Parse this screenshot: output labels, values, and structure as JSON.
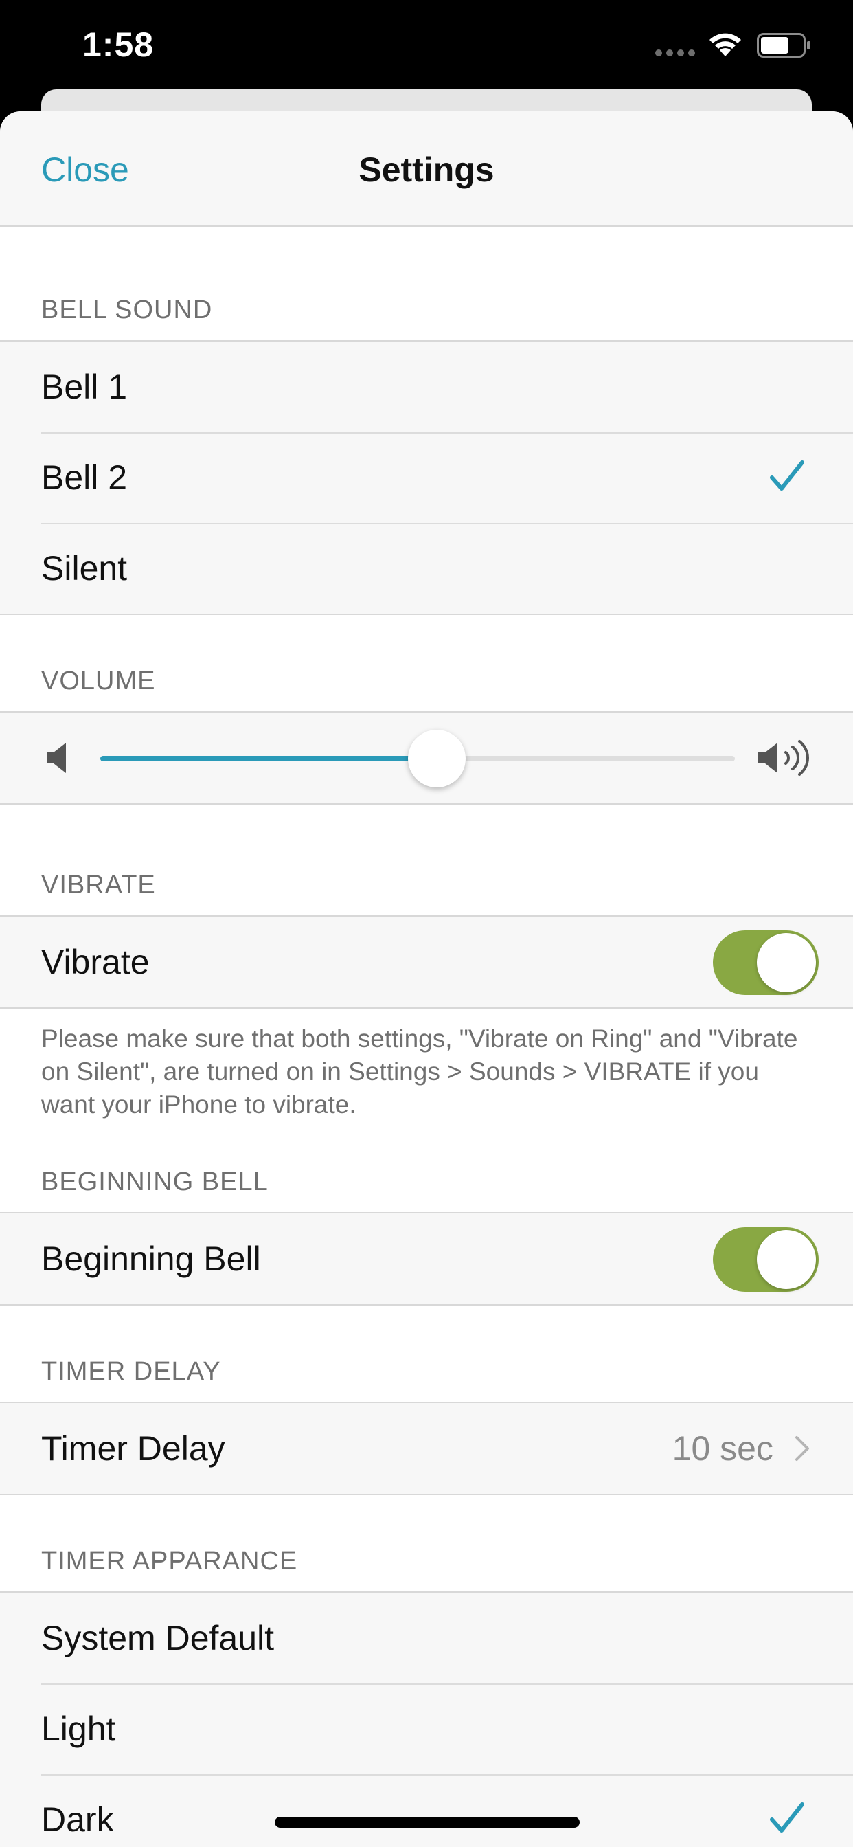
{
  "status_bar": {
    "time": "1:58"
  },
  "navbar": {
    "close_label": "Close",
    "title": "Settings"
  },
  "bell_sound": {
    "header": "BELL SOUND",
    "options": [
      "Bell 1",
      "Bell 2",
      "Silent"
    ],
    "selected": "Bell 2"
  },
  "volume": {
    "header": "VOLUME",
    "level": 0.53
  },
  "vibrate": {
    "header": "VIBRATE",
    "label": "Vibrate",
    "on": true,
    "footer": "Please make sure that both settings, \"Vibrate on Ring\" and \"Vibrate on Silent\", are turned on in Settings > Sounds > VIBRATE if you want your iPhone to vibrate."
  },
  "beginning_bell": {
    "header": "BEGINNING BELL",
    "label": "Beginning Bell",
    "on": true
  },
  "timer_delay": {
    "header": "TIMER DELAY",
    "label": "Timer Delay",
    "value": "10 sec"
  },
  "timer_appearance": {
    "header": "TIMER APPARANCE",
    "options": [
      "System Default",
      "Light",
      "Dark"
    ],
    "selected": "Dark"
  },
  "colors": {
    "accent": "#2a9ab8",
    "toggle_on": "#89a843",
    "background": "#f7f7f7"
  }
}
